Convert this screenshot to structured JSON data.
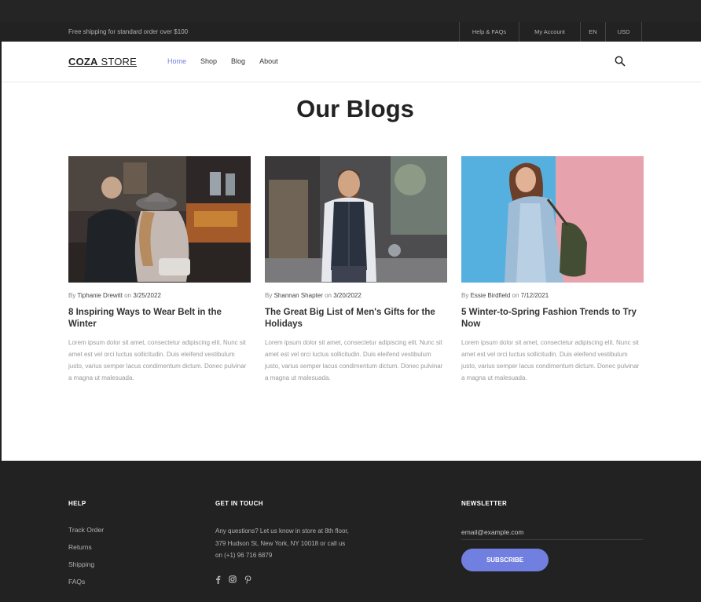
{
  "topbar": {
    "promo": "Free shipping for standard order over $100",
    "links": [
      "Help & FAQs",
      "My Account",
      "EN",
      "USD"
    ]
  },
  "header": {
    "logo_bold": "COZA",
    "logo_light": " STORE",
    "nav": [
      "Home",
      "Shop",
      "Blog",
      "About"
    ],
    "active_nav": "Home",
    "accent_color": "#717fe0"
  },
  "page_title": "Our Blogs",
  "blogs": [
    {
      "by": "By",
      "author": "Tiphanie Drewitt",
      "on": "on",
      "date": "3/25/2022",
      "title": "8 Inspiring Ways to Wear Belt in the Winter",
      "excerpt": "Lorem ipsum dolor sit amet, consectetur adipiscing elit. Nunc sit amet est vel orci luctus sollicitudin. Duis eleifend vestibulum justo, varius semper lacus condimentum dictum. Donec pulvinar a magna ut malesuada."
    },
    {
      "by": "By",
      "author": "Shannan Shapter",
      "on": "on",
      "date": "3/20/2022",
      "title": "The Great Big List of Men's Gifts for the Holidays",
      "excerpt": "Lorem ipsum dolor sit amet, consectetur adipiscing elit. Nunc sit amet est vel orci luctus sollicitudin. Duis eleifend vestibulum justo, varius semper lacus condimentum dictum. Donec pulvinar a magna ut malesuada."
    },
    {
      "by": "By",
      "author": "Essie Birdfield",
      "on": "on",
      "date": "7/12/2021",
      "title": "5 Winter-to-Spring Fashion Trends to Try Now",
      "excerpt": "Lorem ipsum dolor sit amet, consectetur adipiscing elit. Nunc sit amet est vel orci luctus sollicitudin. Duis eleifend vestibulum justo, varius semper lacus condimentum dictum. Donec pulvinar a magna ut malesuada."
    }
  ],
  "footer": {
    "help_heading": "HELP",
    "help_links": [
      "Track Order",
      "Returns",
      "Shipping",
      "FAQs"
    ],
    "touch_heading": "GET IN TOUCH",
    "touch_text": "Any questions? Let us know in store at 8th floor, 379 Hudson St, New York, NY 10018 or call us on (+1) 96 716 6879",
    "social_icons": [
      "facebook-icon",
      "instagram-icon",
      "pinterest-icon"
    ],
    "newsletter_heading": "NEWSLETTER",
    "email_placeholder": "email@example.com",
    "subscribe_label": "SUBSCRIBE"
  }
}
